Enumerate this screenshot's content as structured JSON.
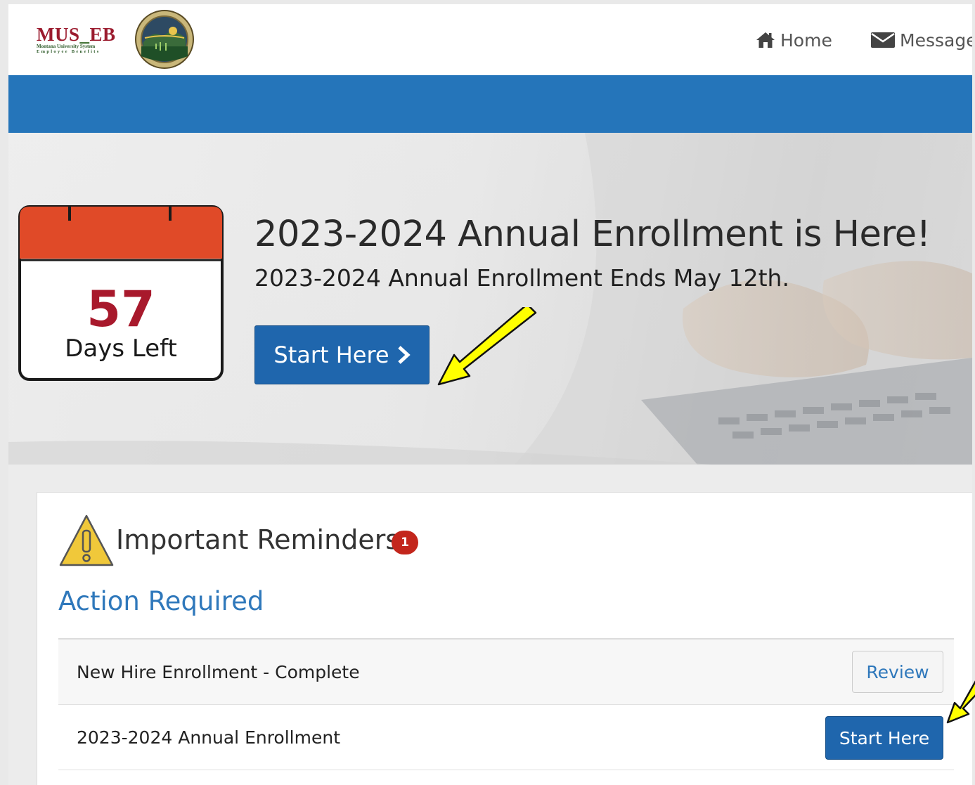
{
  "header": {
    "logo": {
      "main_left": "MUS",
      "main_dash": "_",
      "main_right": "EB",
      "subtitle_1": "Montana University System",
      "subtitle_2": "Employee Benefits"
    },
    "nav": [
      {
        "label": "Home",
        "icon": "home-icon"
      },
      {
        "label": "Message",
        "icon": "envelope-icon"
      }
    ],
    "band_color": "#2575ba"
  },
  "hero": {
    "days_number": "57",
    "days_label": "Days Left",
    "title": "2023-2024 Annual Enrollment is Here!",
    "subtitle": "2023-2024 Annual Enrollment Ends May 12th.",
    "button_label": "Start Here",
    "button_icon": "chevron-right-icon"
  },
  "reminders": {
    "title": "Important Reminders",
    "badge_count": "1",
    "section_title": "Action Required",
    "rows": [
      {
        "label": "New Hire Enrollment - Complete",
        "button": "Review"
      },
      {
        "label": "2023-2024 Annual Enrollment",
        "button": "Start Here"
      }
    ]
  },
  "colors": {
    "primary_blue": "#1f66ad",
    "link_blue": "#2f78bb",
    "calendar_red": "#e04a28",
    "days_red": "#a8192c",
    "badge_red": "#c3261c",
    "annotation_yellow": "#ffff00"
  }
}
